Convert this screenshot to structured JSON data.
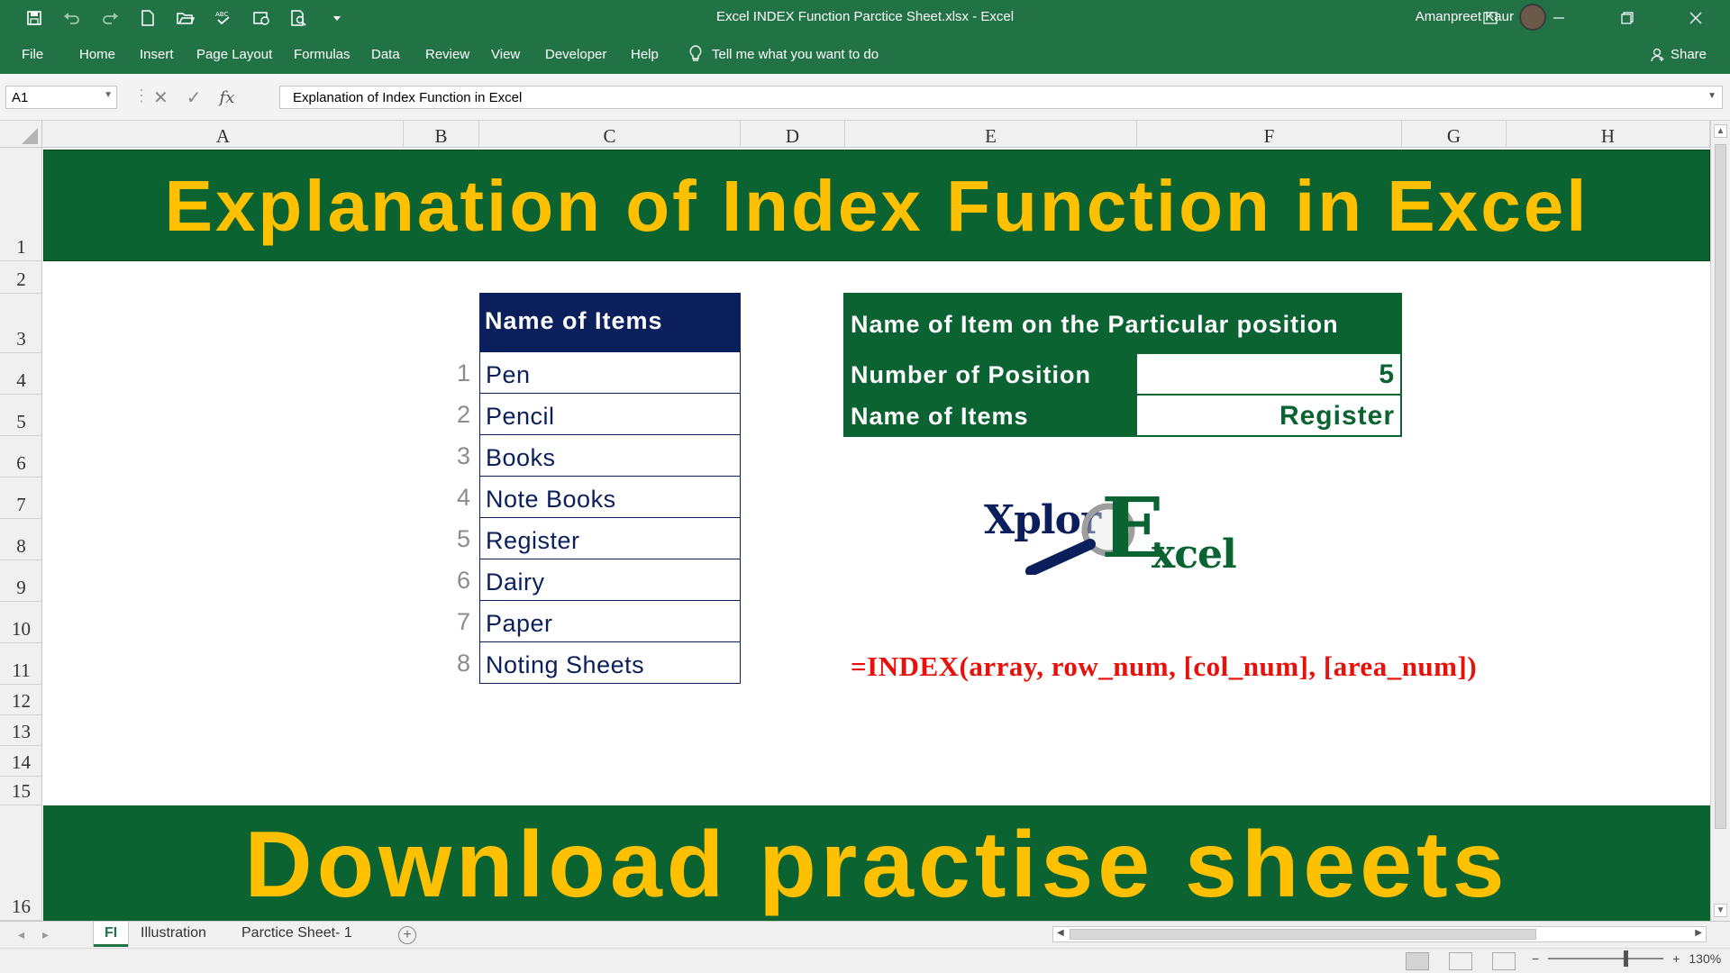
{
  "window": {
    "title": "Excel INDEX Function Parctice Sheet.xlsx  -  Excel",
    "user": "Amanpreet Kaur"
  },
  "ribbon": {
    "tabs": [
      "File",
      "Home",
      "Insert",
      "Page Layout",
      "Formulas",
      "Data",
      "Review",
      "View",
      "Developer",
      "Help"
    ],
    "tell_me": "Tell me what you want to do",
    "share": "Share"
  },
  "formula_bar": {
    "name_box": "A1",
    "content": "Explanation of Index Function in Excel",
    "fx": "fx"
  },
  "columns": [
    "A",
    "B",
    "C",
    "D",
    "E",
    "F",
    "G",
    "H"
  ],
  "rows": [
    "1",
    "2",
    "3",
    "4",
    "5",
    "6",
    "7",
    "8",
    "9",
    "10",
    "11",
    "12",
    "13",
    "14",
    "15",
    "16"
  ],
  "sheet": {
    "banner_title": "Explanation of Index Function in Excel",
    "items_table": {
      "header": "Name of Items",
      "items": [
        {
          "num": "1",
          "name": "Pen"
        },
        {
          "num": "2",
          "name": "Pencil"
        },
        {
          "num": "3",
          "name": "Books"
        },
        {
          "num": "4",
          "name": "Note Books"
        },
        {
          "num": "5",
          "name": "Register"
        },
        {
          "num": "6",
          "name": "Dairy"
        },
        {
          "num": "7",
          "name": "Paper"
        },
        {
          "num": "8",
          "name": "Noting Sheets"
        }
      ]
    },
    "position_table": {
      "header": "Name of Item on the Particular position",
      "position_label": "Number of Position",
      "position_value": "5",
      "item_label": "Name of Items",
      "item_value": "Register"
    },
    "logo": {
      "part1": "Xplor",
      "part2": "E",
      "part3": "xcel"
    },
    "formula_syntax": "=INDEX(array, row_num, [col_num], [area_num])",
    "bottom_banner": "Download practise sheets"
  },
  "sheet_tabs": [
    "FI",
    "Illustration",
    "Parctice Sheet- 1"
  ],
  "status": {
    "zoom": "130%"
  },
  "colors": {
    "excel_green": "#217346",
    "dark_green": "#0a6331",
    "gold": "#ffc000",
    "navy": "#0a1f5c",
    "red": "#e8100b"
  }
}
